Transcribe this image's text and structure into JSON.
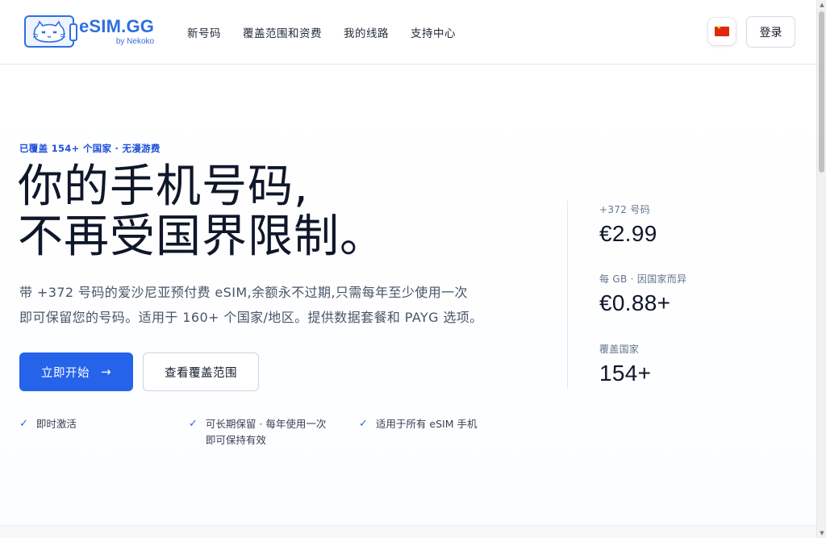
{
  "header": {
    "logo": {
      "title": "eSIM.GG",
      "subtitle": "by Nekoko"
    },
    "nav": [
      {
        "label": "新号码"
      },
      {
        "label": "覆盖范围和资费"
      },
      {
        "label": "我的线路"
      },
      {
        "label": "支持中心"
      }
    ],
    "language_icon": "china-flag-icon",
    "login_label": "登录"
  },
  "hero": {
    "eyebrow": "已覆盖 154+ 个国家 · 无漫游费",
    "headline": [
      "你的手机号码,",
      "不再受国界限制。"
    ],
    "description": [
      "带 +372 号码的爱沙尼亚预付费 eSIM,余额永不过期,只需每年至少使用一次",
      "即可保留您的号码。适用于 160+ 个国家/地区。提供数据套餐和 PAYG 选项。"
    ],
    "primary_cta": "立即开始",
    "primary_cta_icon": "arrow-right-icon",
    "secondary_cta": "查看覆盖范围",
    "features": [
      {
        "lines": [
          "即时激活"
        ]
      },
      {
        "lines": [
          "可长期保留 · 每年使用一次",
          "即可保持有效"
        ]
      },
      {
        "lines": [
          "适用于所有 eSIM 手机"
        ]
      }
    ]
  },
  "stats": [
    {
      "label": "+372 号码",
      "value": "€2.99"
    },
    {
      "label": "每 GB · 因国家而异",
      "value": "€0.88+"
    },
    {
      "label": "覆盖国家",
      "value": "154+"
    }
  ],
  "colors": {
    "brand": "#2f6fe0",
    "accent": "#2563eb",
    "eyebrow": "#1d4fd8",
    "text_primary": "#0f172a",
    "text_secondary": "#475569"
  }
}
